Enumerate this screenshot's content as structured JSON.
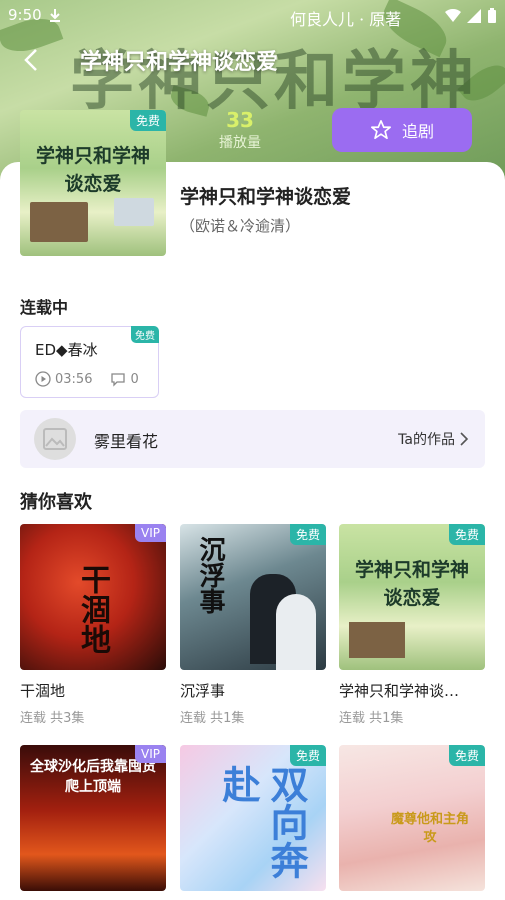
{
  "status_bar": {
    "time": "9:50"
  },
  "header": {
    "bg_title": "学神只和学神",
    "bg_subtitle": "何良人儿 · 原著",
    "title": "学神只和学神谈恋爱",
    "play_count": "33",
    "play_label": "播放量",
    "follow_label": "追剧"
  },
  "drama": {
    "cover_badge": "免费",
    "cover_text": "学神只和学神谈恋爱",
    "name": "学神只和学神谈恋爱",
    "cast": "（欧诺＆冷逾清）"
  },
  "episodes": {
    "section_title": "连载中",
    "items": [
      {
        "title": "ED◆春冰",
        "duration": "03:56",
        "comments": "0",
        "badge": "免费"
      }
    ]
  },
  "author": {
    "name": "雾里看花",
    "works_label": "Ta的作品"
  },
  "recommend": {
    "section_title": "猜你喜欢",
    "items": [
      {
        "title": "干涸地",
        "sub": "连载 共3集",
        "badge": "VIP",
        "art": "干涸地"
      },
      {
        "title": "沉浮事",
        "sub": "连载 共1集",
        "badge": "免费",
        "art": "沉浮事"
      },
      {
        "title": "学神只和学神谈…",
        "sub": "连载 共1集",
        "badge": "免费",
        "art": "学神只和学神谈恋爱"
      },
      {
        "title": "",
        "sub": "",
        "badge": "VIP",
        "art": "全球沙化后我靠囤货爬上顶端"
      },
      {
        "title": "",
        "sub": "",
        "badge": "免费",
        "art": "双向奔赴"
      },
      {
        "title": "",
        "sub": "",
        "badge": "免费",
        "art": "魔尊他和主角攻"
      }
    ]
  },
  "colors": {
    "accent": "#9b6cf1",
    "free_badge": "#2bb5a8",
    "vip_badge": "#9a82f0"
  }
}
